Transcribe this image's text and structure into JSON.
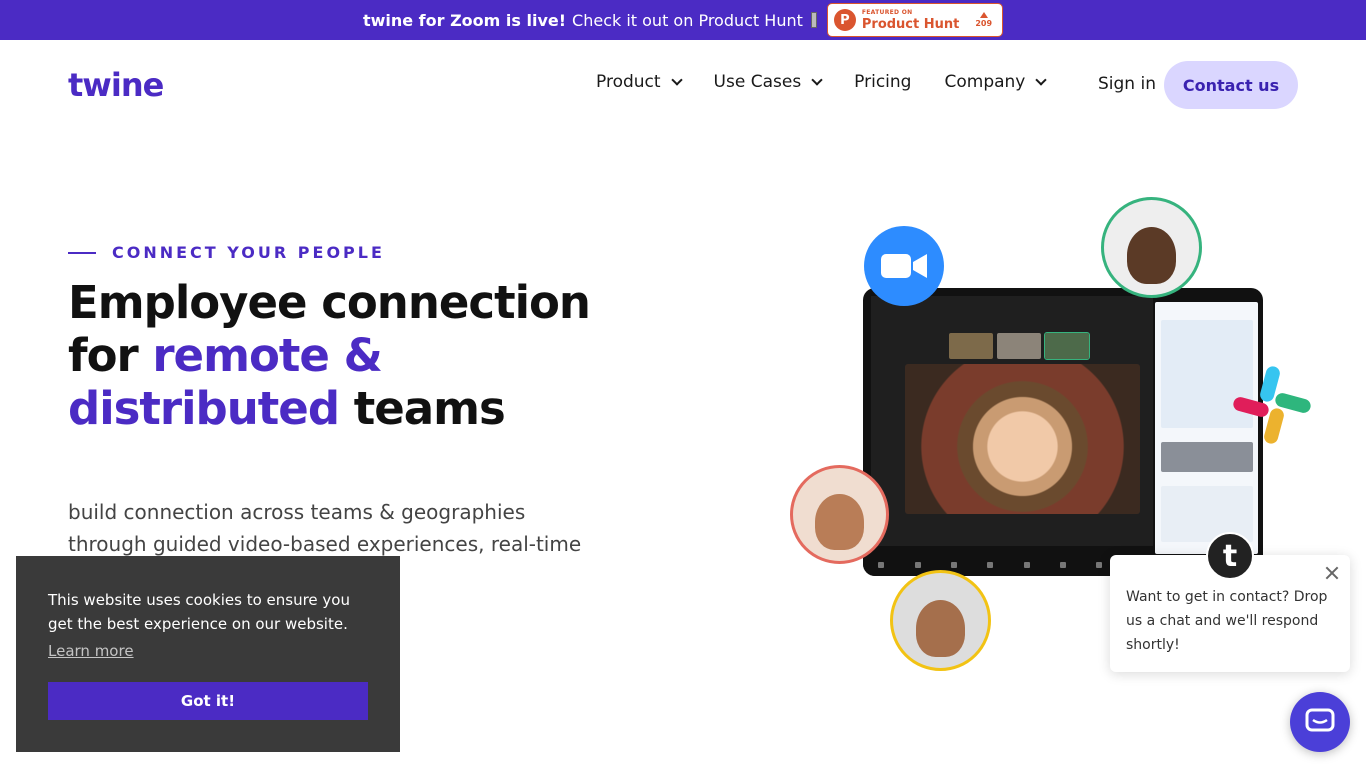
{
  "banner": {
    "bold_text": "twine for Zoom is live!",
    "text": "Check it out on Product Hunt",
    "badge": {
      "small_label": "FEATURED ON",
      "big_label": "Product Hunt",
      "votes": "209"
    }
  },
  "header": {
    "logo": "twine",
    "nav": [
      {
        "label": "Product",
        "has_dropdown": true
      },
      {
        "label": "Use Cases",
        "has_dropdown": true
      },
      {
        "label": "Pricing",
        "has_dropdown": false
      },
      {
        "label": "Company",
        "has_dropdown": true
      }
    ],
    "sign_in": "Sign in",
    "contact": "Contact us"
  },
  "hero": {
    "eyebrow": "CONNECT YOUR PEOPLE",
    "headline_part1": "Employee connection for ",
    "headline_accent": "remote & distributed",
    "headline_part2": " teams",
    "subtext": "build connection across teams & geographies through guided video-based experiences, real-time insights, &"
  },
  "cookie": {
    "message": "This website uses cookies to ensure you get the best experience on our website.",
    "learn_more": "Learn more",
    "button": "Got it!"
  },
  "chat": {
    "avatar_letter": "t",
    "message": "Want to get in contact? Drop us a chat and we'll respond shortly!"
  },
  "colors": {
    "brand": "#4B2BC4",
    "contact_bg": "#DAD6FF",
    "zoom_blue": "#2D8CFF",
    "product_hunt": "#DA552F"
  },
  "icons": [
    "product-hunt-icon",
    "chevron-down-icon",
    "zoom-camera-icon",
    "slack-icon",
    "close-icon",
    "chat-icon"
  ]
}
